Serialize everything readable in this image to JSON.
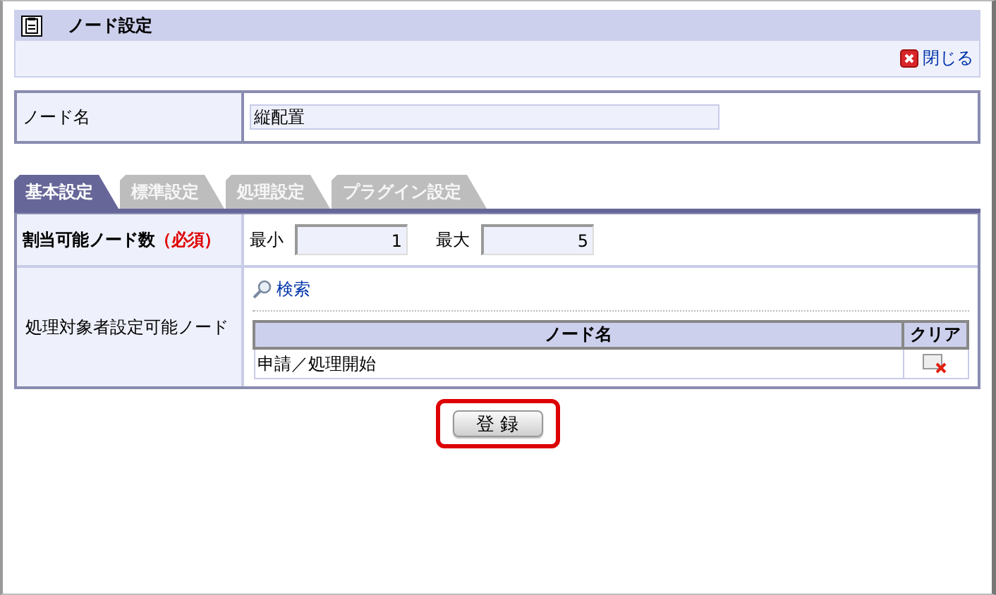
{
  "window": {
    "title": "ノード設定",
    "close_link": "閉じる"
  },
  "node_name": {
    "label": "ノード名",
    "value": "縦配置"
  },
  "tabs": [
    {
      "label": "基本設定",
      "selected": true
    },
    {
      "label": "標準設定",
      "selected": false
    },
    {
      "label": "処理設定",
      "selected": false
    },
    {
      "label": "プラグイン設定",
      "selected": false
    }
  ],
  "allocation": {
    "label": "割当可能ノード数",
    "required": "（必須）",
    "min_label": "最小",
    "min_value": "1",
    "max_label": "最大",
    "max_value": "5"
  },
  "target_nodes": {
    "label": "処理対象者設定可能ノード",
    "search_link": "検索",
    "columns": [
      "ノード名",
      "クリア"
    ],
    "rows": [
      {
        "node_name": "申請／処理開始"
      }
    ]
  },
  "submit_button": {
    "label": "登 録",
    "highlighted": true
  }
}
